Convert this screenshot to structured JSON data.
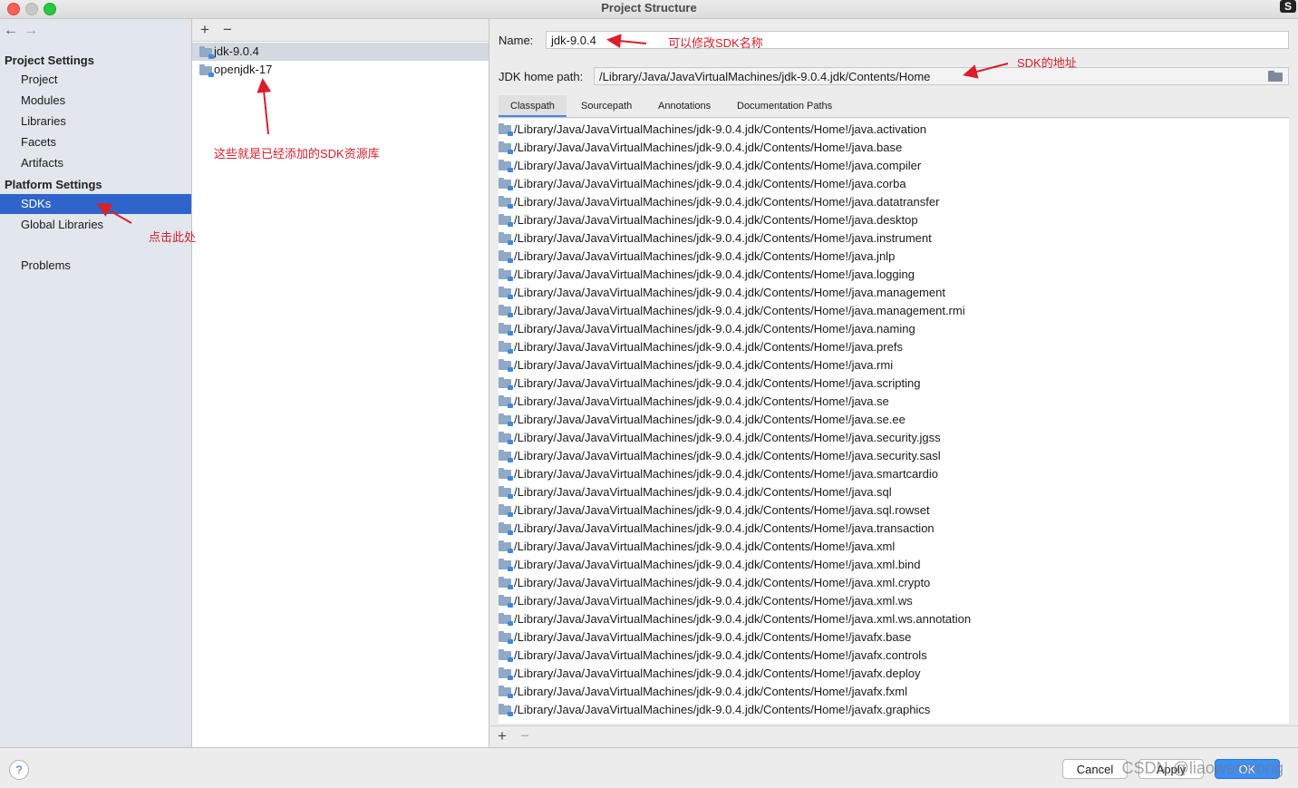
{
  "window": {
    "title": "Project Structure"
  },
  "nav": {
    "back": "←",
    "forward": "→"
  },
  "sidebar": {
    "project_settings": "Project Settings",
    "project_items": [
      "Project",
      "Modules",
      "Libraries",
      "Facets",
      "Artifacts"
    ],
    "platform_settings": "Platform Settings",
    "platform_items": [
      "SDKs",
      "Global Libraries"
    ],
    "problems": "Problems",
    "selected": "SDKs"
  },
  "sdk_list": {
    "add": "+",
    "remove": "−",
    "items": [
      "jdk-9.0.4",
      "openjdk-17"
    ],
    "selected": "jdk-9.0.4"
  },
  "details": {
    "name_label": "Name:",
    "name_value": "jdk-9.0.4",
    "home_label": "JDK home path:",
    "home_value": "/Library/Java/JavaVirtualMachines/jdk-9.0.4.jdk/Contents/Home",
    "tabs": [
      "Classpath",
      "Sourcepath",
      "Annotations",
      "Documentation Paths"
    ],
    "active_tab": "Classpath",
    "classpath_prefix": "/Library/Java/JavaVirtualMachines/jdk-9.0.4.jdk/Contents/Home!/",
    "classpath": [
      "java.activation",
      "java.base",
      "java.compiler",
      "java.corba",
      "java.datatransfer",
      "java.desktop",
      "java.instrument",
      "java.jnlp",
      "java.logging",
      "java.management",
      "java.management.rmi",
      "java.naming",
      "java.prefs",
      "java.rmi",
      "java.scripting",
      "java.se",
      "java.se.ee",
      "java.security.jgss",
      "java.security.sasl",
      "java.smartcardio",
      "java.sql",
      "java.sql.rowset",
      "java.transaction",
      "java.xml",
      "java.xml.bind",
      "java.xml.crypto",
      "java.xml.ws",
      "java.xml.ws.annotation",
      "javafx.base",
      "javafx.controls",
      "javafx.deploy",
      "javafx.fxml",
      "javafx.graphics"
    ],
    "add": "+",
    "remove": "−"
  },
  "footer": {
    "help": "?",
    "cancel": "Cancel",
    "apply": "Apply",
    "ok": "OK",
    "watermark": "CSDN @liaowenxiong"
  },
  "annotations": {
    "name_note": "可以修改SDK名称",
    "path_note": "SDK的地址",
    "list_note": "这些就是已经添加的SDK资源库",
    "click_note": "点击此处",
    "color": "#d8202a"
  },
  "colors": {
    "selection": "#2f65ca",
    "accent": "#3d8ef5"
  }
}
